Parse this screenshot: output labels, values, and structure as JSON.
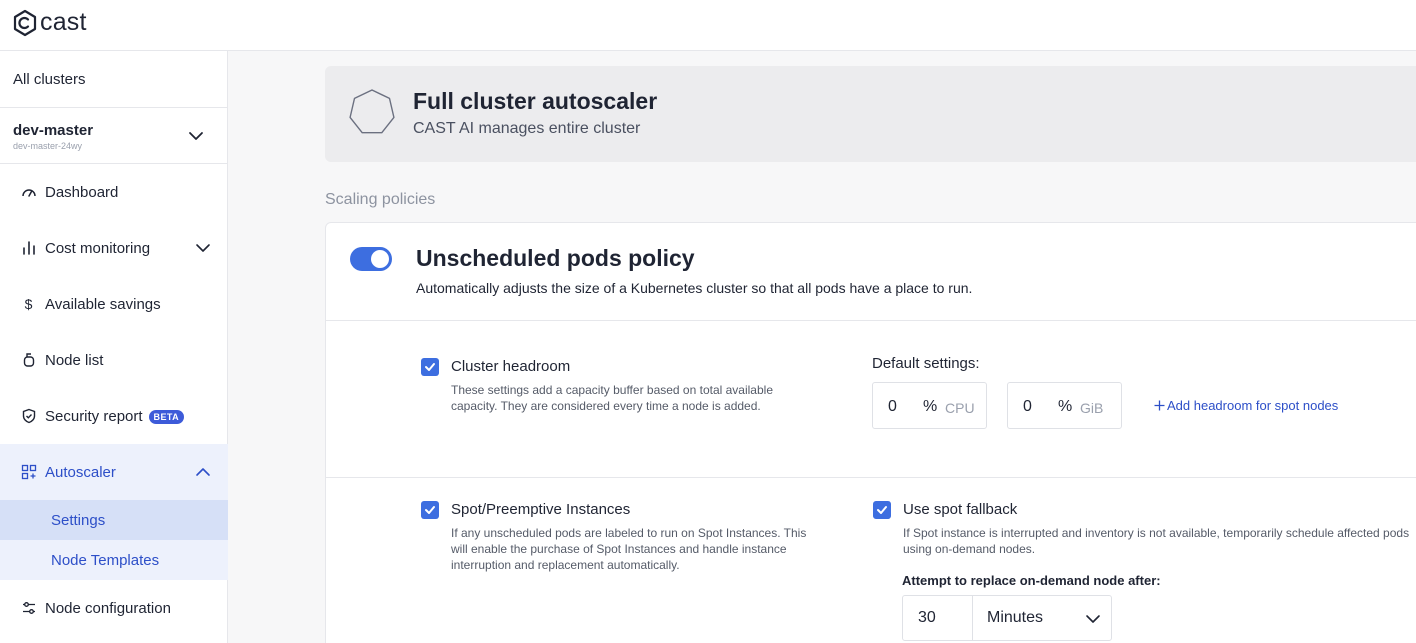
{
  "brand": {
    "name": "cast"
  },
  "sidebar": {
    "all_clusters": "All clusters",
    "cluster": {
      "name": "dev-master",
      "id": "dev-master-24wy"
    },
    "items": [
      {
        "label": "Dashboard",
        "icon": "gauge-icon"
      },
      {
        "label": "Cost monitoring",
        "icon": "bar-chart-icon"
      },
      {
        "label": "Available savings",
        "icon": "dollar-icon"
      },
      {
        "label": "Node list",
        "icon": "node-icon"
      },
      {
        "label": "Security report",
        "icon": "shield-icon",
        "badge": "BETA"
      },
      {
        "label": "Autoscaler",
        "icon": "grid-icon",
        "active": true
      },
      {
        "label": "Node configuration",
        "icon": "sliders-icon"
      }
    ],
    "autoscaler_sub": [
      {
        "label": "Settings",
        "selected": true
      },
      {
        "label": "Node Templates",
        "selected": false
      }
    ]
  },
  "mode": {
    "title": "Full cluster autoscaler",
    "subtitle": "CAST AI manages entire cluster"
  },
  "section_label": "Scaling policies",
  "policy": {
    "enabled": true,
    "title": "Unscheduled pods policy",
    "description": "Automatically adjusts the size of a Kubernetes cluster so that all pods have a place to run.",
    "headroom": {
      "checked": true,
      "title": "Cluster headroom",
      "description": "These settings add a capacity buffer based on total available capacity. They are considered every time a node is added.",
      "defaults_label": "Default settings:",
      "cpu": {
        "value": "0",
        "percent": "%",
        "unit": "CPU"
      },
      "memory": {
        "value": "0",
        "percent": "%",
        "unit": "GiB"
      },
      "add_spot_link": "Add headroom for spot nodes"
    },
    "spot": {
      "checked": true,
      "title": "Spot/Preemptive Instances",
      "description": "If any unscheduled pods are labeled to run on Spot Instances. This will enable the purchase of Spot Instances and handle instance interruption and replacement automatically."
    },
    "fallback": {
      "checked": true,
      "title": "Use spot fallback",
      "description": "If Spot instance is interrupted and inventory is not available, temporarily schedule affected pods using on-demand nodes.",
      "attempt_label": "Attempt to replace on-demand node after:",
      "value": "30",
      "unit": "Minutes"
    }
  },
  "colors": {
    "accent": "#3d6ee0",
    "link": "#2d4fc8",
    "active_bg": "#edf1fc",
    "selected_bg": "#d6e0f7"
  }
}
